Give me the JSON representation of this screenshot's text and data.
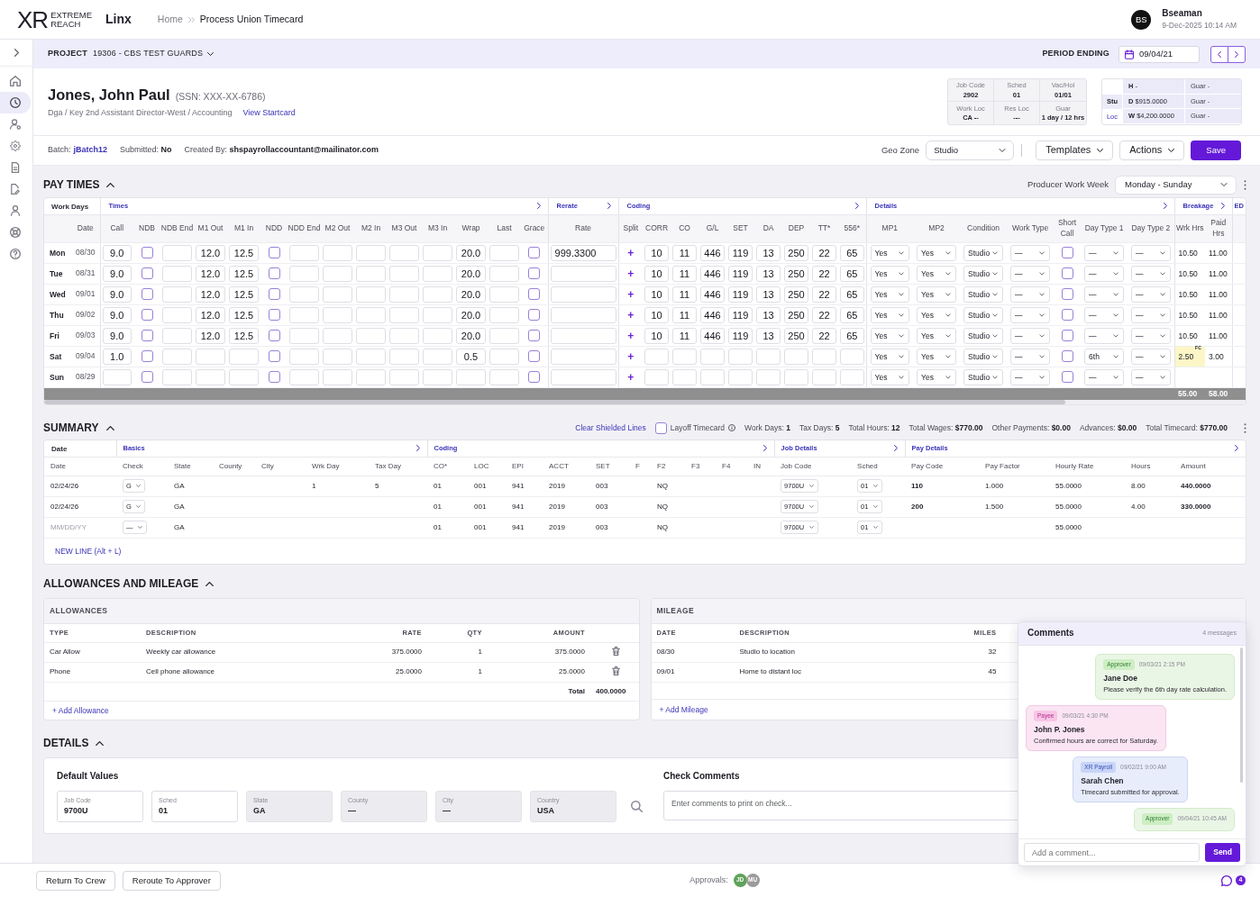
{
  "header": {
    "logo": {
      "mark": "XR",
      "wordmark": [
        "EXTREME",
        "REACH"
      ]
    },
    "app": "Linx",
    "breadcrumb": [
      "Home",
      "Process Union Timecard"
    ],
    "user": {
      "initials": "BS",
      "name": "Bseaman",
      "datetime": "9-Dec-2025 10:14 AM"
    }
  },
  "sidebar": {
    "items": [
      {
        "selected": false
      },
      {
        "selected": true
      },
      {
        "selected": false
      },
      {
        "selected": false
      },
      {
        "selected": false
      },
      {
        "selected": false
      },
      {
        "selected": false
      },
      {
        "selected": false
      },
      {
        "selected": false
      }
    ]
  },
  "project_bar": {
    "label": "PROJECT",
    "project": "19306 - CBS TEST GUARDS",
    "period_label": "PERIOD ENDING",
    "period_ending": "09/04/21"
  },
  "employee": {
    "name": "Jones, John Paul",
    "ssn": "(SSN: XXX-XX-6786)",
    "role": "Dga / Key 2nd Assistant Director-West / Accounting",
    "link": "View Startcard",
    "info": [
      {
        "label": "Job Code",
        "value": "2902"
      },
      {
        "label": "Sched",
        "value": "01"
      },
      {
        "label": "Vac/Hol",
        "value": "01/01"
      },
      {
        "label": "Work Loc",
        "value": "CA --"
      },
      {
        "label": "Res Loc",
        "value": "---"
      },
      {
        "label": "Guar",
        "value": "1 day / 12 hrs"
      }
    ],
    "rates": [
      {
        "rate": "**H** -",
        "guar": "Guar -"
      },
      {
        "label": "Stu",
        "selected": true,
        "rate": "**D** $915.0000",
        "guar": "Guar -"
      },
      {
        "label": "Loc",
        "selected": false,
        "rate": "**W** $4,200.0000",
        "guar": "Guar -"
      }
    ]
  },
  "batch_bar": {
    "items": [
      {
        "kind": "link",
        "label": "Batch:",
        "value": "jBatch12"
      },
      {
        "kind": "bold",
        "label": "Submitted:",
        "value": "No"
      },
      {
        "kind": "bold",
        "label": "Created By:",
        "value": "shspayrollaccountant@mailinator.com"
      }
    ],
    "geo_zone": {
      "label": "Geo Zone",
      "value": "Studio"
    },
    "buttons": [
      {
        "kind": "dropdown",
        "label": "Templates"
      },
      {
        "kind": "dropdown",
        "label": "Actions"
      },
      {
        "kind": "primary",
        "label": "Save"
      }
    ]
  },
  "pay_times": {
    "title": "PAY TIMES",
    "expanded": true,
    "work_week": {
      "label": "Producer Work Week",
      "value": "Monday - Sunday"
    },
    "groups": [
      {
        "label": "Work Days",
        "kind": "plain",
        "columns": [
          {
            "kind": "day"
          },
          {
            "label": "Date",
            "kind": "date"
          }
        ]
      },
      {
        "label": "Times",
        "kind": "link",
        "columns": [
          {
            "label": "Call",
            "kind": "input"
          },
          {
            "label": "NDB",
            "kind": "check"
          },
          {
            "label": "NDB End",
            "kind": "input"
          },
          {
            "label": "M1 Out",
            "kind": "input"
          },
          {
            "label": "M1 In",
            "kind": "input"
          },
          {
            "label": "NDD",
            "kind": "check"
          },
          {
            "label": "NDD End",
            "kind": "input"
          },
          {
            "label": "M2 Out",
            "kind": "input"
          },
          {
            "label": "M2 In",
            "kind": "input"
          },
          {
            "label": "M3 Out",
            "kind": "input"
          },
          {
            "label": "M3 In",
            "kind": "input"
          },
          {
            "label": "Wrap",
            "kind": "input"
          },
          {
            "label": "Last",
            "kind": "input"
          },
          {
            "label": "Grace",
            "kind": "check"
          }
        ]
      },
      {
        "label": "Rerate",
        "kind": "link",
        "columns": [
          {
            "label": "Rate",
            "kind": "rate"
          }
        ]
      },
      {
        "label": "Coding",
        "kind": "link",
        "columns": [
          {
            "label": "Split",
            "kind": "add"
          },
          {
            "label": "CORR",
            "kind": "input"
          },
          {
            "label": "CO",
            "kind": "input"
          },
          {
            "label": "G/L",
            "kind": "input"
          },
          {
            "label": "SET",
            "kind": "input"
          },
          {
            "label": "DA",
            "kind": "input"
          },
          {
            "label": "DEP",
            "kind": "input"
          },
          {
            "label": "TT*",
            "kind": "input"
          },
          {
            "label": "556*",
            "kind": "input"
          }
        ]
      },
      {
        "label": "Details",
        "kind": "link",
        "columns": [
          {
            "label": "MP1",
            "kind": "select"
          },
          {
            "label": "MP2",
            "kind": "select"
          },
          {
            "label": "Condition",
            "kind": "select"
          },
          {
            "label": "Work Type",
            "kind": "select"
          },
          {
            "label": "Short Call",
            "kind": "check"
          },
          {
            "label": "Day Type 1",
            "kind": "select"
          },
          {
            "label": "Day Type 2",
            "kind": "select"
          }
        ]
      },
      {
        "label": "Breakage",
        "kind": "link",
        "columns": [
          {
            "label": "Wrk Hrs",
            "kind": "hours"
          },
          {
            "label": "Paid Hrs",
            "kind": "hours"
          }
        ]
      },
      {
        "label": "ED",
        "kind": "link"
      }
    ],
    "rows": [
      {
        "flagged": false,
        "day": "Mon",
        "date": "08/30",
        "call": "9.0",
        "ndb": false,
        "m1_out": "12.0",
        "m1_in": "12.5",
        "ndd": false,
        "wrap": "20.0",
        "grace": false,
        "rate": "999.3300",
        "split": "+",
        "corr": "10",
        "co": "11",
        "gl": "446",
        "set": "119",
        "da": "13",
        "dep": "250",
        "tt": "22",
        "f556": "65",
        "mp1": "Yes",
        "mp2": "Yes",
        "condition": "Studio",
        "work_type": "—",
        "short_call": false,
        "day_type_1": "—",
        "day_type_2": "—",
        "wrk_hrs": "10.50",
        "paid_hrs": "11.00"
      },
      {
        "flagged": false,
        "day": "Tue",
        "date": "08/31",
        "call": "9.0",
        "ndb": false,
        "m1_out": "12.0",
        "m1_in": "12.5",
        "ndd": false,
        "wrap": "20.0",
        "grace": false,
        "split": "+",
        "corr": "10",
        "co": "11",
        "gl": "446",
        "set": "119",
        "da": "13",
        "dep": "250",
        "tt": "22",
        "f556": "65",
        "mp1": "Yes",
        "mp2": "Yes",
        "condition": "Studio",
        "work_type": "—",
        "short_call": false,
        "day_type_1": "—",
        "day_type_2": "—",
        "wrk_hrs": "10.50",
        "paid_hrs": "11.00"
      },
      {
        "flagged": false,
        "day": "Wed",
        "date": "09/01",
        "call": "9.0",
        "ndb": false,
        "m1_out": "12.0",
        "m1_in": "12.5",
        "ndd": false,
        "wrap": "20.0",
        "grace": false,
        "split": "+",
        "corr": "10",
        "co": "11",
        "gl": "446",
        "set": "119",
        "da": "13",
        "dep": "250",
        "tt": "22",
        "f556": "65",
        "mp1": "Yes",
        "mp2": "Yes",
        "condition": "Studio",
        "work_type": "—",
        "short_call": false,
        "day_type_1": "—",
        "day_type_2": "—",
        "wrk_hrs": "10.50",
        "paid_hrs": "11.00"
      },
      {
        "flagged": false,
        "day": "Thu",
        "date": "09/02",
        "call": "9.0",
        "ndb": false,
        "m1_out": "12.0",
        "m1_in": "12.5",
        "ndd": false,
        "wrap": "20.0",
        "grace": false,
        "split": "+",
        "corr": "10",
        "co": "11",
        "gl": "446",
        "set": "119",
        "da": "13",
        "dep": "250",
        "tt": "22",
        "f556": "65",
        "mp1": "Yes",
        "mp2": "Yes",
        "condition": "Studio",
        "work_type": "—",
        "short_call": false,
        "day_type_1": "—",
        "day_type_2": "—",
        "wrk_hrs": "10.50",
        "paid_hrs": "11.00"
      },
      {
        "flagged": false,
        "day": "Fri",
        "date": "09/03",
        "call": "9.0",
        "ndb": false,
        "m1_out": "12.0",
        "m1_in": "12.5",
        "ndd": false,
        "wrap": "20.0",
        "grace": false,
        "split": "+",
        "corr": "10",
        "co": "11",
        "gl": "446",
        "set": "119",
        "da": "13",
        "dep": "250",
        "tt": "22",
        "f556": "65",
        "mp1": "Yes",
        "mp2": "Yes",
        "condition": "Studio",
        "work_type": "—",
        "short_call": false,
        "day_type_1": "—",
        "day_type_2": "—",
        "wrk_hrs": "10.50",
        "paid_hrs": "11.00"
      },
      {
        "flagged": true,
        "day": "Sat",
        "date": "09/04",
        "call": "1.0",
        "ndb": false,
        "ndd": false,
        "wrap": "0.5",
        "grace": false,
        "split": "+",
        "mp1": "Yes",
        "mp2": "Yes",
        "condition": "Studio",
        "work_type": "—",
        "short_call": false,
        "day_type_1": "6th",
        "day_type_2": "—",
        "wrk_hrs": "2.50$^{FC}$",
        "paid_hrs": "3.00"
      },
      {
        "flagged": false,
        "day": "Sun",
        "date": "08/29",
        "ndb": false,
        "ndd": false,
        "grace": false,
        "split": "+",
        "mp1": "Yes",
        "mp2": "Yes",
        "condition": "Studio",
        "work_type": "—",
        "short_call": false,
        "day_type_1": "—",
        "day_type_2": "—"
      }
    ],
    "totals": [
      "55.00",
      "58.00"
    ]
  },
  "summary": {
    "title": "SUMMARY",
    "expanded": true,
    "clear_link": "Clear Shielded Lines",
    "layoff": {
      "label": "Layoff Timecard",
      "checked": false
    },
    "stats": [
      {
        "label": "Work Days:",
        "value": "1"
      },
      {
        "label": "Tax Days:",
        "value": "5"
      },
      {
        "label": "Total Hours:",
        "value": "12"
      },
      {
        "label": "Total Wages:",
        "value": "$770.00"
      },
      {
        "label": "Other Payments:",
        "value": "$0.00"
      },
      {
        "label": "Advances:",
        "value": "$0.00"
      },
      {
        "label": "Total Timecard:",
        "value": "$770.00"
      }
    ],
    "groups": [
      {
        "label": "Date",
        "kind": "plain",
        "columns": [
          {
            "label": "Date",
            "kind": "date"
          }
        ]
      },
      {
        "label": "Basics",
        "kind": "link",
        "columns": [
          {
            "label": "Check",
            "kind": "select"
          },
          {
            "label": "State",
            "kind": "text"
          },
          {
            "label": "County",
            "kind": "text"
          },
          {
            "label": "City",
            "kind": "text"
          },
          {
            "label": "Wrk Day",
            "kind": "text"
          },
          {
            "label": "Tax Day",
            "kind": "text"
          }
        ]
      },
      {
        "label": "Coding",
        "kind": "link",
        "columns": [
          {
            "label": "CO*",
            "kind": "text"
          },
          {
            "label": "LOC",
            "kind": "text"
          },
          {
            "label": "EPI",
            "kind": "text"
          },
          {
            "label": "ACCT",
            "kind": "text"
          },
          {
            "label": "SET",
            "kind": "text"
          },
          {
            "label": "F",
            "kind": "text"
          },
          {
            "label": "F2",
            "kind": "text"
          },
          {
            "label": "F3",
            "kind": "text"
          },
          {
            "label": "F4",
            "kind": "text"
          },
          {
            "label": "IN",
            "kind": "text"
          }
        ]
      },
      {
        "label": "Job Details",
        "kind": "link",
        "columns": [
          {
            "label": "Job Code",
            "kind": "select"
          },
          {
            "label": "Sched",
            "kind": "select"
          }
        ]
      },
      {
        "label": "Pay Details",
        "kind": "link",
        "columns": [
          {
            "label": "Pay Code",
            "kind": "bold"
          },
          {
            "label": "Pay Factor",
            "kind": "text"
          },
          {
            "label": "Hourly Rate",
            "kind": "text"
          },
          {
            "label": "Hours",
            "kind": "text"
          },
          {
            "label": "Amount",
            "kind": "bold"
          }
        ]
      }
    ],
    "rows": [
      {
        "date": "02/24/26",
        "check": "G",
        "state": "GA",
        "wrk_day": "1",
        "tax_day": "5",
        "co": "01",
        "loc": "001",
        "epi": "941",
        "acct": "2019",
        "set": "003",
        "f2": "NQ",
        "job_code": "9700U",
        "sched": "01",
        "pay_code": "110",
        "pay_factor": "1.000",
        "hourly_rate": "55.0000",
        "hours": "8.00",
        "amount": "440.0000"
      },
      {
        "date": "02/24/26",
        "check": "G",
        "state": "GA",
        "co": "01",
        "loc": "001",
        "epi": "941",
        "acct": "2019",
        "set": "003",
        "f2": "NQ",
        "job_code": "9700U",
        "sched": "01",
        "pay_code": "200",
        "pay_factor": "1.500",
        "hourly_rate": "55.0000",
        "hours": "4.00",
        "amount": "330.0000"
      },
      {
        "placeholder": "MM/DD/YY",
        "check": "—",
        "state": "GA",
        "co": "01",
        "loc": "001",
        "epi": "941",
        "acct": "2019",
        "set": "003",
        "f2": "NQ",
        "job_code": "9700U",
        "sched": "01",
        "hourly_rate": "55.0000"
      }
    ],
    "new_line": "NEW LINE (Alt + L)"
  },
  "allowances_mileage": {
    "title": "ALLOWANCES AND MILEAGE",
    "expanded": true,
    "allowances": {
      "title": "ALLOWANCES",
      "columns": [
        "TYPE",
        "DESCRIPTION",
        "RATE",
        "QTY",
        "AMOUNT"
      ],
      "rows": [
        [
          "Car Allow",
          "Weekly car allowance",
          "375.0000",
          "1",
          "375.0000"
        ],
        [
          "Phone",
          "Cell phone allowance",
          "25.0000",
          "1",
          "25.0000"
        ]
      ],
      "total_label": "Total",
      "total": "400.0000",
      "add": "+ Add Allowance"
    },
    "mileage": {
      "title": "MILEAGE",
      "columns": [
        "DATE",
        "DESCRIPTION",
        "MILES"
      ],
      "rows": [
        [
          "08/30",
          "Studio to location",
          "32"
        ],
        [
          "09/01",
          "Home to distant loc",
          "45"
        ]
      ],
      "add": "+ Add Mileage"
    }
  },
  "details": {
    "title": "DETAILS",
    "expanded": true,
    "default_values": {
      "title": "Default Values",
      "fields": [
        {
          "label": "Job Code",
          "value": "9700U",
          "disabled": false
        },
        {
          "label": "Sched",
          "value": "01",
          "disabled": false
        },
        {
          "label": "State",
          "value": "GA",
          "disabled": true
        },
        {
          "label": "County",
          "value": "—",
          "disabled": true
        },
        {
          "label": "City",
          "value": "—",
          "disabled": true
        },
        {
          "label": "Country",
          "value": "USA",
          "disabled": true
        }
      ]
    },
    "check_comments": {
      "title": "Check Comments",
      "placeholder": "Enter comments to print on check..."
    }
  },
  "comments": {
    "title": "Comments",
    "count": "4 messages",
    "messages": [
      {
        "kind": "approver",
        "role": "Approver",
        "time": "09/03/21 2:15 PM",
        "author": "Jane Doe",
        "text": "Please verify the 6th day rate calculation."
      },
      {
        "kind": "payee",
        "role": "Payee",
        "time": "09/03/21 4:30 PM",
        "author": "John P. Jones",
        "text": "Confirmed hours are correct for Saturday."
      },
      {
        "kind": "payroll",
        "role": "XR Payroll",
        "time": "09/02/21 9:00 AM",
        "author": "Sarah Chen",
        "text": "Timecard submitted for approval."
      },
      {
        "kind": "approver",
        "role": "Approver",
        "time": "09/04/21 10:45 AM"
      }
    ],
    "placeholder": "Add a comment...",
    "send": "Send"
  },
  "footer": {
    "buttons": [
      "Return To Crew",
      "Reroute To Approver"
    ],
    "approvals_label": "Approvals:",
    "approvers": [
      {
        "initials": "JD",
        "color": "#5fa35a"
      },
      {
        "initials": "MU",
        "color": "#9b9b9b"
      }
    ],
    "unread": "4"
  }
}
